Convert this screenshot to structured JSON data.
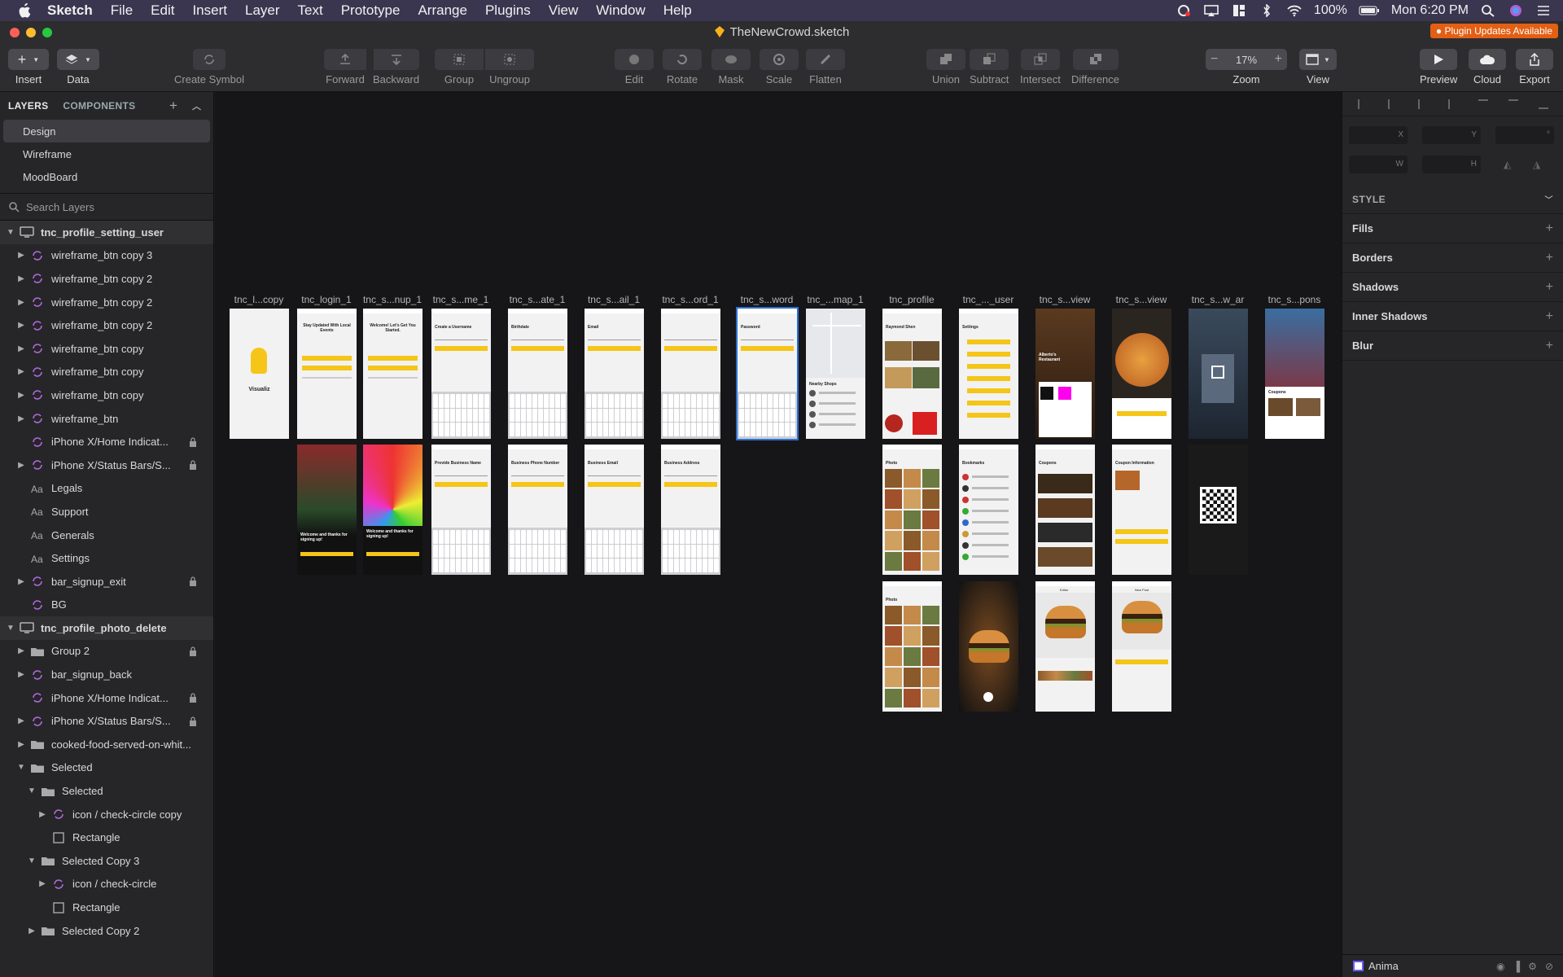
{
  "menubar": {
    "app": "Sketch",
    "items": [
      "File",
      "Edit",
      "Insert",
      "Layer",
      "Text",
      "Prototype",
      "Arrange",
      "Plugins",
      "View",
      "Window",
      "Help"
    ],
    "battery": "100%",
    "clock": "Mon 6:20 PM"
  },
  "window": {
    "title": "TheNewCrowd.sketch",
    "plugin_badge": "Plugin Updates Available"
  },
  "toolbar": {
    "insert": "Insert",
    "data": "Data",
    "create_symbol": "Create Symbol",
    "forward": "Forward",
    "backward": "Backward",
    "group": "Group",
    "ungroup": "Ungroup",
    "edit": "Edit",
    "rotate": "Rotate",
    "mask": "Mask",
    "scale": "Scale",
    "flatten": "Flatten",
    "union": "Union",
    "subtract": "Subtract",
    "intersect": "Intersect",
    "difference": "Difference",
    "zoom_label": "Zoom",
    "zoom_value": "17%",
    "view": "View",
    "preview": "Preview",
    "cloud": "Cloud",
    "export": "Export"
  },
  "sidebar": {
    "tab_layers": "LAYERS",
    "tab_components": "COMPONENTS",
    "pages": [
      "Design",
      "Wireframe",
      "MoodBoard"
    ],
    "search_placeholder": "Search Layers",
    "layers": [
      {
        "name": "tnc_profile_setting_user",
        "type": "artboard",
        "indent": 0,
        "open": true,
        "lock": false
      },
      {
        "name": "wireframe_btn copy 3",
        "type": "symbol",
        "indent": 1,
        "open": false,
        "lock": false
      },
      {
        "name": "wireframe_btn copy 2",
        "type": "symbol",
        "indent": 1,
        "open": false,
        "lock": false
      },
      {
        "name": "wireframe_btn copy 2",
        "type": "symbol",
        "indent": 1,
        "open": false,
        "lock": false
      },
      {
        "name": "wireframe_btn copy 2",
        "type": "symbol",
        "indent": 1,
        "open": false,
        "lock": false
      },
      {
        "name": "wireframe_btn copy",
        "type": "symbol",
        "indent": 1,
        "open": false,
        "lock": false
      },
      {
        "name": "wireframe_btn copy",
        "type": "symbol",
        "indent": 1,
        "open": false,
        "lock": false
      },
      {
        "name": "wireframe_btn copy",
        "type": "symbol",
        "indent": 1,
        "open": false,
        "lock": false
      },
      {
        "name": "wireframe_btn",
        "type": "symbol",
        "indent": 1,
        "open": false,
        "lock": false
      },
      {
        "name": "iPhone X/Home Indicat...",
        "type": "symbol",
        "indent": 1,
        "open": null,
        "lock": true
      },
      {
        "name": "iPhone X/Status Bars/S...",
        "type": "symbol",
        "indent": 1,
        "open": false,
        "lock": true
      },
      {
        "name": "Legals",
        "type": "text",
        "indent": 1,
        "open": null,
        "lock": false
      },
      {
        "name": "Support",
        "type": "text",
        "indent": 1,
        "open": null,
        "lock": false
      },
      {
        "name": "Generals",
        "type": "text",
        "indent": 1,
        "open": null,
        "lock": false
      },
      {
        "name": "Settings",
        "type": "text",
        "indent": 1,
        "open": null,
        "lock": false
      },
      {
        "name": "bar_signup_exit",
        "type": "symbol",
        "indent": 1,
        "open": false,
        "lock": true
      },
      {
        "name": "BG",
        "type": "symbol",
        "indent": 1,
        "open": null,
        "lock": false
      },
      {
        "name": "tnc_profile_photo_delete",
        "type": "artboard",
        "indent": 0,
        "open": true,
        "lock": false
      },
      {
        "name": "Group 2",
        "type": "folder",
        "indent": 1,
        "open": false,
        "lock": true
      },
      {
        "name": "bar_signup_back",
        "type": "symbol",
        "indent": 1,
        "open": false,
        "lock": false
      },
      {
        "name": "iPhone X/Home Indicat...",
        "type": "symbol",
        "indent": 1,
        "open": null,
        "lock": true
      },
      {
        "name": "iPhone X/Status Bars/S...",
        "type": "symbol",
        "indent": 1,
        "open": false,
        "lock": true
      },
      {
        "name": "cooked-food-served-on-whit...",
        "type": "folder",
        "indent": 1,
        "open": false,
        "lock": false
      },
      {
        "name": "Selected",
        "type": "folder",
        "indent": 1,
        "open": true,
        "lock": false
      },
      {
        "name": "Selected",
        "type": "folder",
        "indent": 2,
        "open": true,
        "lock": false
      },
      {
        "name": "icon / check-circle copy",
        "type": "symbol",
        "indent": 3,
        "open": false,
        "lock": false
      },
      {
        "name": "Rectangle",
        "type": "rect",
        "indent": 3,
        "open": null,
        "lock": false
      },
      {
        "name": "Selected Copy 3",
        "type": "folder",
        "indent": 2,
        "open": true,
        "lock": false
      },
      {
        "name": "icon / check-circle",
        "type": "symbol",
        "indent": 3,
        "open": false,
        "lock": false
      },
      {
        "name": "Rectangle",
        "type": "rect",
        "indent": 3,
        "open": null,
        "lock": false
      },
      {
        "name": "Selected Copy 2",
        "type": "folder",
        "indent": 2,
        "open": false,
        "lock": false
      }
    ]
  },
  "canvas": {
    "artboards": [
      {
        "label": "tnc_l...copy",
        "col": 0,
        "row": 0,
        "kind": "splash",
        "text": "Visualiz"
      },
      {
        "label": "tnc_login_1",
        "col": 1,
        "row": 0,
        "kind": "form",
        "text": "Stay Updated With Local Events"
      },
      {
        "label": "tnc_s...nup_1",
        "col": 2,
        "row": 0,
        "kind": "form",
        "text": "Welcome! Let's Get You Started."
      },
      {
        "label": "tnc_s...me_1",
        "col": 3,
        "row": 0,
        "kind": "keyboard",
        "text": "Create a Username"
      },
      {
        "label": "tnc_s...ate_1",
        "col": 4,
        "row": 0,
        "kind": "keyboard",
        "text": "Birthdate"
      },
      {
        "label": "tnc_s...ail_1",
        "col": 5,
        "row": 0,
        "kind": "keyboard",
        "text": "Email"
      },
      {
        "label": "tnc_s...ord_1",
        "col": 6,
        "row": 0,
        "kind": "keyboard",
        "text": ""
      },
      {
        "label": "tnc_s...word",
        "col": 7,
        "row": 0,
        "kind": "keyboard",
        "text": "Password"
      },
      {
        "label": "tnc_...map_1",
        "col": 8,
        "row": 0,
        "kind": "map",
        "text": "Nearby Shops"
      },
      {
        "label": "tnc_profile",
        "col": 9,
        "row": 0,
        "kind": "profile",
        "text": "Raymond Shen"
      },
      {
        "label": "tnc_..._user",
        "col": 10,
        "row": 0,
        "kind": "settings",
        "text": "Settings"
      },
      {
        "label": "tnc_s...view",
        "col": 11,
        "row": 0,
        "kind": "photo",
        "text": "Alberto's Restaurant"
      },
      {
        "label": "tnc_s...view",
        "col": 12,
        "row": 0,
        "kind": "pizza",
        "text": ""
      },
      {
        "label": "tnc_s...w_ar",
        "col": 13,
        "row": 0,
        "kind": "city",
        "text": ""
      },
      {
        "label": "tnc_s...pons",
        "col": 14,
        "row": 0,
        "kind": "street",
        "text": "Coupons"
      },
      {
        "label": "",
        "col": 1,
        "row": 1,
        "kind": "alley",
        "text": "Welcome and thanks for signing up!"
      },
      {
        "label": "",
        "col": 2,
        "row": 1,
        "kind": "umbrella",
        "text": "Welcome and thanks for signing up!"
      },
      {
        "label": "",
        "col": 3,
        "row": 1,
        "kind": "keyboard",
        "text": "Provide Business Name"
      },
      {
        "label": "",
        "col": 4,
        "row": 1,
        "kind": "keyboard",
        "text": "Business Phone Number"
      },
      {
        "label": "",
        "col": 5,
        "row": 1,
        "kind": "keyboard",
        "text": "Business Email"
      },
      {
        "label": "",
        "col": 6,
        "row": 1,
        "kind": "keyboard",
        "text": "Business Address"
      },
      {
        "label": "",
        "col": 9,
        "row": 1,
        "kind": "grid",
        "text": "Photo"
      },
      {
        "label": "",
        "col": 10,
        "row": 1,
        "kind": "list",
        "text": "Bookmarks"
      },
      {
        "label": "",
        "col": 11,
        "row": 1,
        "kind": "coupons",
        "text": "Coupons"
      },
      {
        "label": "",
        "col": 12,
        "row": 1,
        "kind": "coupon",
        "text": "Coupon Information"
      },
      {
        "label": "",
        "col": 13,
        "row": 1,
        "kind": "qr",
        "text": ""
      },
      {
        "label": "",
        "col": 9,
        "row": 2,
        "kind": "grid",
        "text": "Photo"
      },
      {
        "label": "",
        "col": 10,
        "row": 2,
        "kind": "burger-dark",
        "text": ""
      },
      {
        "label": "",
        "col": 11,
        "row": 2,
        "kind": "burger",
        "text": "Editor"
      },
      {
        "label": "",
        "col": 12,
        "row": 2,
        "kind": "burger-post",
        "text": "New Post"
      }
    ]
  },
  "inspector": {
    "x_label": "X",
    "y_label": "Y",
    "w_label": "W",
    "h_label": "H",
    "rotation_label": "°",
    "style": "STYLE",
    "sections": [
      "Fills",
      "Borders",
      "Shadows",
      "Inner Shadows",
      "Blur"
    ],
    "plugin": "Anima"
  },
  "colors": {
    "accent_yellow": "#f5c518",
    "menubar": "#3a3650",
    "selection": "#2b6fd6",
    "plugin_badge": "#e35f14"
  }
}
